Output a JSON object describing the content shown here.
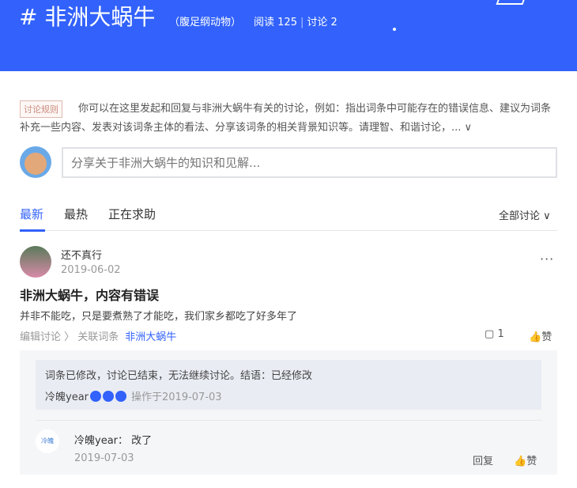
{
  "header": {
    "title": "# 非洲大蜗牛",
    "category": "（腹足纲动物）",
    "read_label": "阅读",
    "read_count": "125",
    "discuss_label": "讨论",
    "discuss_count": "2"
  },
  "rules": {
    "tag": "讨论规则",
    "text": "你可以在这里发起和回复与非洲大蜗牛有关的讨论，例如：指出词条中可能存在的错误信息、建议为词条补充一些内容、发表对该词条主体的看法、分享该词条的相关背景知识等。请理智、和谐讨论，... ∨"
  },
  "input": {
    "placeholder": "分享关于非洲大蜗牛的知识和见解..."
  },
  "tabs": [
    {
      "label": "最新"
    },
    {
      "label": "最热"
    },
    {
      "label": "正在求助"
    }
  ],
  "filter": "全部讨论 ∨",
  "post": {
    "user": "还不真行",
    "date": "2019-06-02",
    "more": "···",
    "title": "非洲大蜗牛，内容有错误",
    "body": "并非不能吃，只是要煮熟了才能吃，我们家乡都吃了好多年了",
    "edit": "编辑讨论",
    "related_label": "〉 关联词条",
    "related_link": "非洲大蜗牛",
    "comment_icon": "▢",
    "comment_count": "1",
    "like": "赞"
  },
  "closed": {
    "text": "词条已修改，讨论已结束，无法继续讨论。结语：已经修改",
    "user": "冷魄year",
    "op": "操作于2019-07-03"
  },
  "reply": {
    "avatar_text": "冷魄",
    "user": "冷魄year：",
    "text": "改了",
    "date": "2019-07-03",
    "reply": "回复",
    "like": "赞"
  }
}
